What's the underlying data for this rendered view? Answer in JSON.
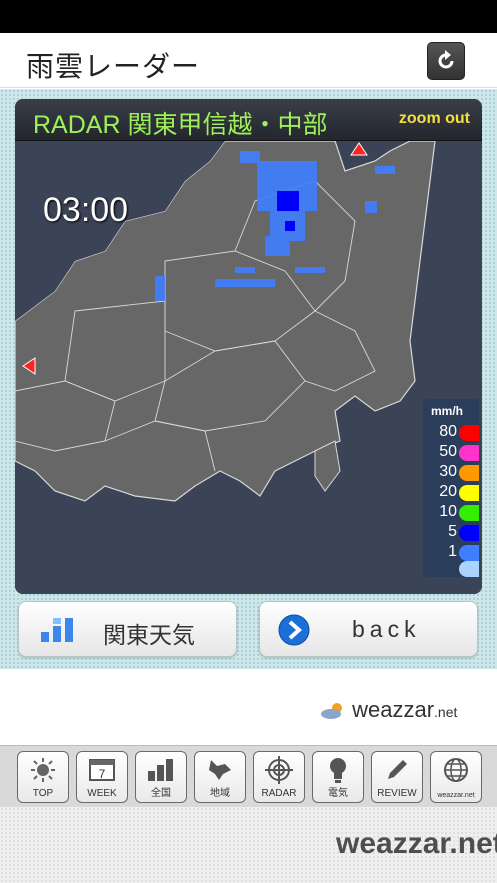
{
  "header": {
    "title": "雨雲レーダー"
  },
  "radar": {
    "title": "RADAR 関東甲信越・中部",
    "zoom_label": "zoom out",
    "time": "03:00",
    "legend": {
      "unit": "mm/h",
      "levels": [
        {
          "label": "80",
          "color": "#ff0000"
        },
        {
          "label": "50",
          "color": "#ff33cc"
        },
        {
          "label": "30",
          "color": "#ff9900"
        },
        {
          "label": "20",
          "color": "#ffff00"
        },
        {
          "label": "10",
          "color": "#33ee00"
        },
        {
          "label": "5",
          "color": "#0000ff"
        },
        {
          "label": "1",
          "color": "#3f7fff"
        },
        {
          "label": "",
          "color": "#aad4ff"
        }
      ]
    }
  },
  "buttons": {
    "region_weather": "関東天気",
    "back": "back"
  },
  "ad": {
    "brand": "weazzar",
    "brand_suffix": ".net"
  },
  "toolbar": {
    "items": [
      {
        "label": "TOP",
        "icon": "sun-icon"
      },
      {
        "label": "WEEK",
        "icon": "calendar-icon",
        "badge": "7"
      },
      {
        "label": "全国",
        "icon": "bars-icon"
      },
      {
        "label": "地域",
        "icon": "hokkaido-icon"
      },
      {
        "label": "RADAR",
        "icon": "radar-icon"
      },
      {
        "label": "電気",
        "icon": "bulb-icon"
      },
      {
        "label": "REVIEW",
        "icon": "pencil-icon"
      },
      {
        "label": "weazzar.net",
        "icon": "globe-icon"
      }
    ]
  },
  "footer": {
    "brand": "weazzar.net"
  }
}
